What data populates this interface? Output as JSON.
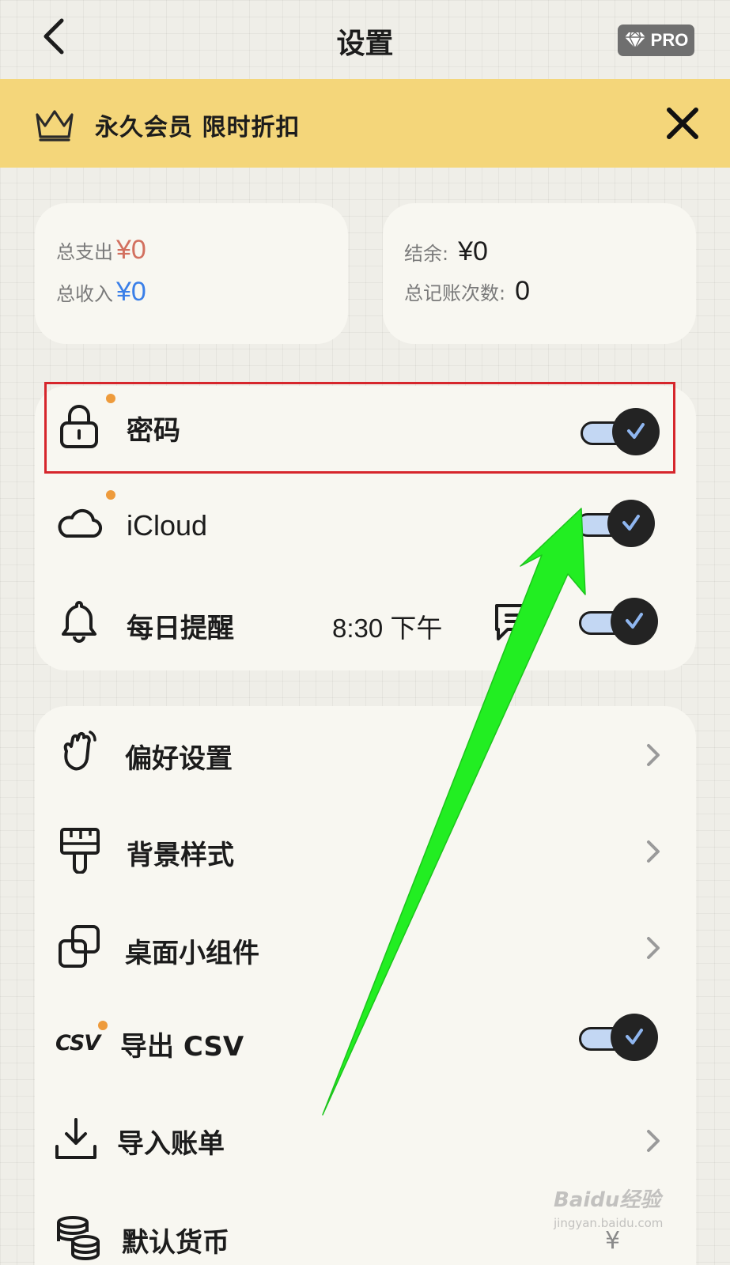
{
  "nav": {
    "title": "设置",
    "pro_label": "PRO"
  },
  "banner": {
    "text": "永久会员 限时折扣"
  },
  "stats": {
    "total_expense_label": "总支出",
    "total_expense_value": "¥0",
    "total_income_label": "总收入",
    "total_income_value": "¥0",
    "balance_label": "结余:",
    "balance_value": "¥0",
    "record_count_label": "总记账次数:",
    "record_count_value": "0"
  },
  "settings_group1": [
    {
      "label": "密码",
      "icon": "lock-icon",
      "toggle": true,
      "toggle_on": true
    },
    {
      "label": "iCloud",
      "icon": "cloud-icon",
      "toggle": true,
      "toggle_on": true
    },
    {
      "label": "每日提醒",
      "icon": "bell-icon",
      "time": "8:30 下午",
      "toggle": true,
      "toggle_on": true
    }
  ],
  "settings_group2": [
    {
      "label": "偏好设置",
      "icon": "hand-icon"
    },
    {
      "label": "背景样式",
      "icon": "paint-brush-icon"
    },
    {
      "label": "桌面小组件",
      "icon": "widget-icon"
    },
    {
      "label": "导出 CSV",
      "icon": "csv-icon",
      "icon_text": "CSV",
      "toggle": true,
      "toggle_on": true
    },
    {
      "label": "导入账单",
      "icon": "download-icon"
    },
    {
      "label": "默认货币",
      "icon": "coins-icon",
      "value": "¥"
    }
  ],
  "watermark": {
    "text": "Baidu经验",
    "sub": "jingyan.baidu.com"
  },
  "colors": {
    "banner": "#f4d67a",
    "expense": "#d2705f",
    "income": "#3a7fe8",
    "dot": "#ee9b3c",
    "highlight": "#d6262c",
    "arrow": "#22ee22"
  }
}
